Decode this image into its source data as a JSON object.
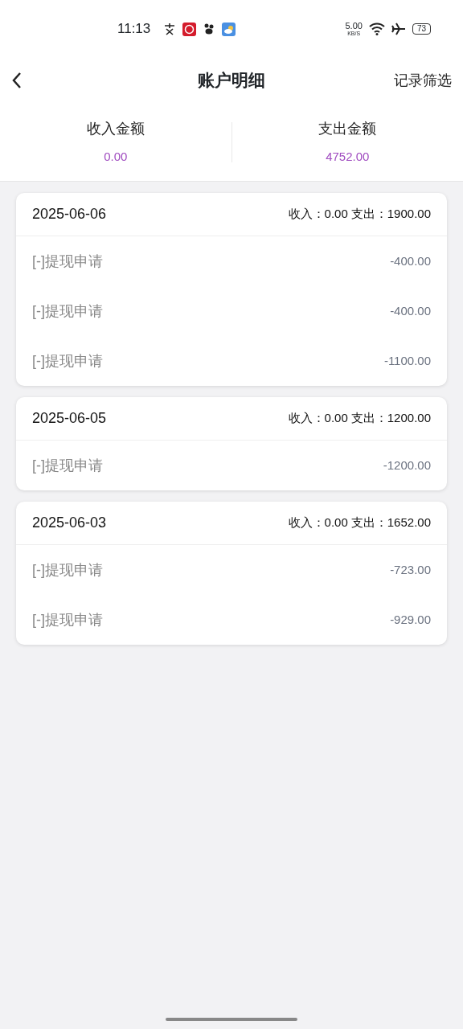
{
  "status_bar": {
    "time": "11:13",
    "net_speed": "5.00",
    "net_unit": "KB/S",
    "battery": "73"
  },
  "header": {
    "title": "账户明细",
    "action": "记录筛选"
  },
  "summary": [
    {
      "label": "收入金额",
      "value": "0.00"
    },
    {
      "label": "支出金额",
      "value": "4752.00"
    }
  ],
  "days": [
    {
      "date": "2025-06-06",
      "income": "收入：0.00",
      "expense": "支出：1900.00",
      "items": [
        {
          "name": "[-]提现申请",
          "amount": "-400.00"
        },
        {
          "name": "[-]提现申请",
          "amount": "-400.00"
        },
        {
          "name": "[-]提现申请",
          "amount": "-1100.00"
        }
      ]
    },
    {
      "date": "2025-06-05",
      "income": "收入：0.00",
      "expense": "支出：1200.00",
      "items": [
        {
          "name": "[-]提现申请",
          "amount": "-1200.00"
        }
      ]
    },
    {
      "date": "2025-06-03",
      "income": "收入：0.00",
      "expense": "支出：1652.00",
      "items": [
        {
          "name": "[-]提现申请",
          "amount": "-723.00"
        },
        {
          "name": "[-]提现申请",
          "amount": "-929.00"
        }
      ]
    }
  ]
}
